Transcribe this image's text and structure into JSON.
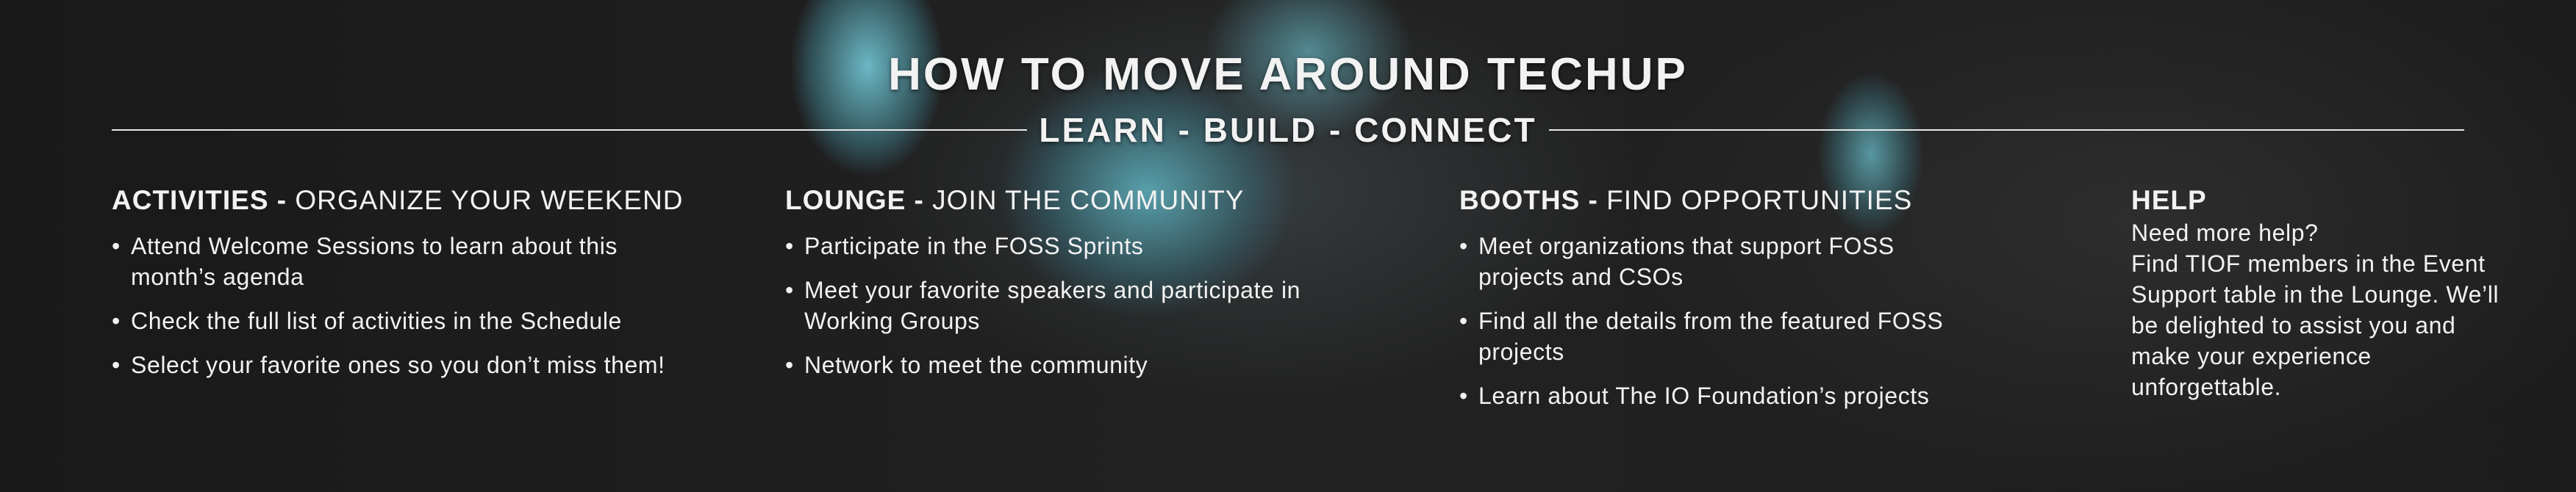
{
  "header": {
    "title": "HOW TO MOVE AROUND TECHUP",
    "subtitle": "LEARN - BUILD - CONNECT"
  },
  "sections": [
    {
      "bold": "ACTIVITIES -",
      "rest": " ORGANIZE YOUR WEEKEND",
      "items": [
        "Attend Welcome Sessions to learn about this month’s agenda",
        "Check the full list of activities in the Schedule",
        "Select your favorite ones so you don’t miss them!"
      ]
    },
    {
      "bold": "LOUNGE -",
      "rest": " JOIN THE COMMUNITY",
      "items": [
        "Participate in the FOSS Sprints",
        "Meet your favorite speakers and participate in Working Groups",
        "Network to meet the community"
      ]
    },
    {
      "bold": "BOOTHS -",
      "rest": " FIND OPPORTUNITIES",
      "items": [
        "Meet organizations that support FOSS projects and CSOs",
        "Find all the details from the featured FOSS projects",
        "Learn about The IO Foundation’s projects"
      ]
    }
  ],
  "help": {
    "title": "HELP",
    "lines": [
      "Need more help?",
      "Find TIOF members in the Event Support table in the Lounge. We’ll be delighted to assist you and make your experience unforgettable."
    ]
  },
  "colors": {
    "background": "#1d1d1d",
    "accent": "#78d2e1",
    "text": "#f2f2f2"
  }
}
